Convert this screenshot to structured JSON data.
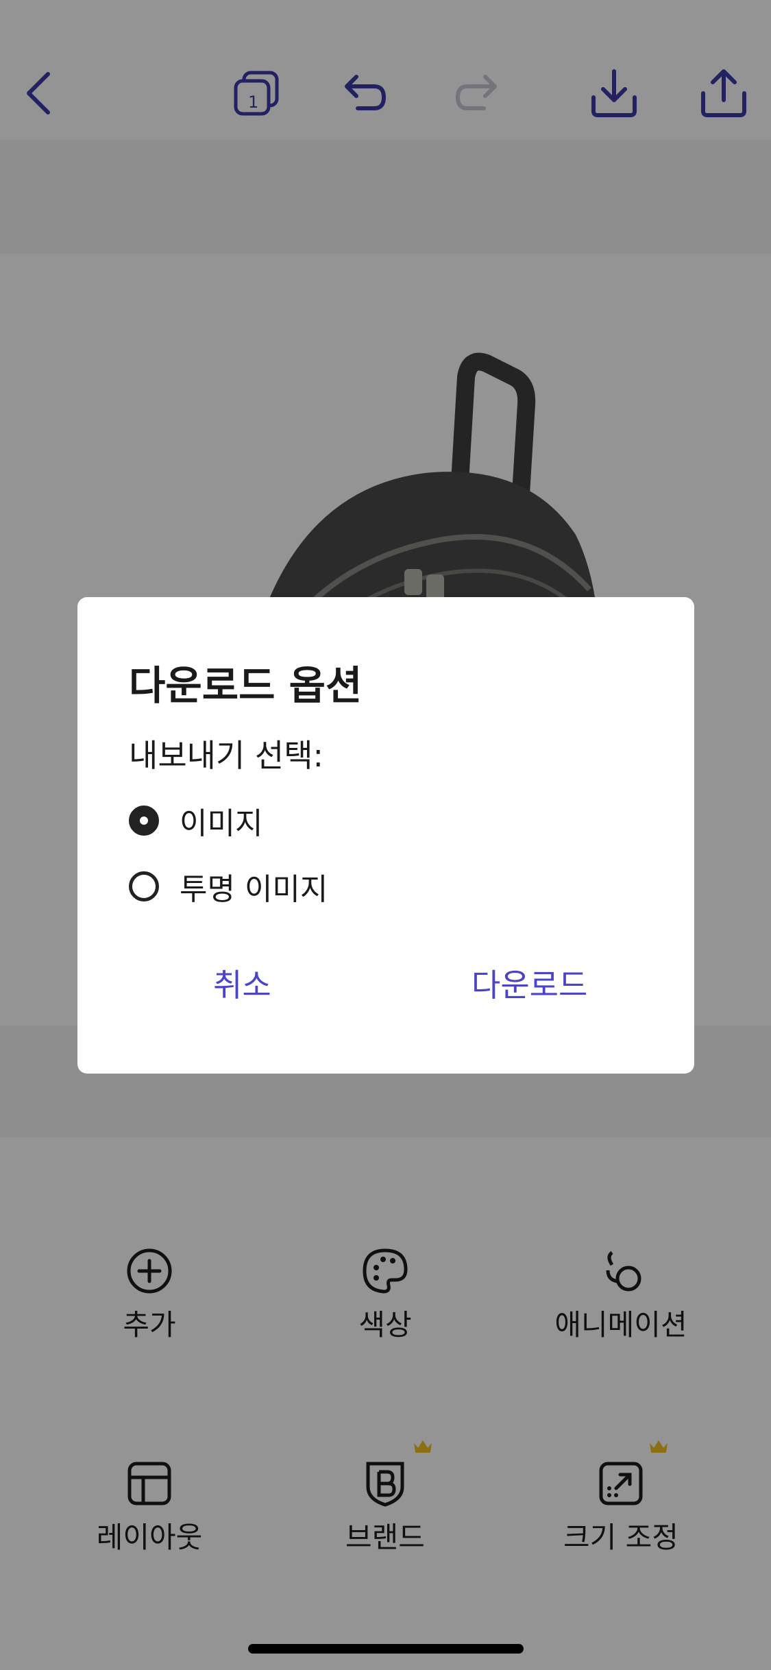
{
  "colors": {
    "accent": "#4b44c9",
    "toolbar_icon": "#3b3aa8",
    "disabled_icon": "#c9c9d6",
    "crown": "#f0c020",
    "scrim": "rgba(0,0,0,0.42)"
  },
  "toolbar": {
    "back_icon": "chevron-left-icon",
    "pages_count": "1",
    "pages_icon": "pages-icon",
    "undo_icon": "undo-icon",
    "redo_icon": "redo-icon",
    "download_icon": "download-icon",
    "share_icon": "share-icon"
  },
  "bottom_tools": [
    {
      "label": "추가",
      "icon": "add-circle-icon"
    },
    {
      "label": "색상",
      "icon": "palette-icon"
    },
    {
      "label": "애니메이션",
      "icon": "animation-icon"
    },
    {
      "label": "레이아웃",
      "icon": "layout-icon"
    },
    {
      "label": "브랜드",
      "icon": "brand-icon",
      "premium": true
    },
    {
      "label": "크기 조정",
      "icon": "resize-icon",
      "premium": true
    }
  ],
  "dialog": {
    "title": "다운로드 옵션",
    "subtitle": "내보내기 선택:",
    "options": [
      {
        "label": "이미지",
        "selected": true
      },
      {
        "label": "투명 이미지",
        "selected": false
      }
    ],
    "cancel_label": "취소",
    "download_label": "다운로드"
  }
}
